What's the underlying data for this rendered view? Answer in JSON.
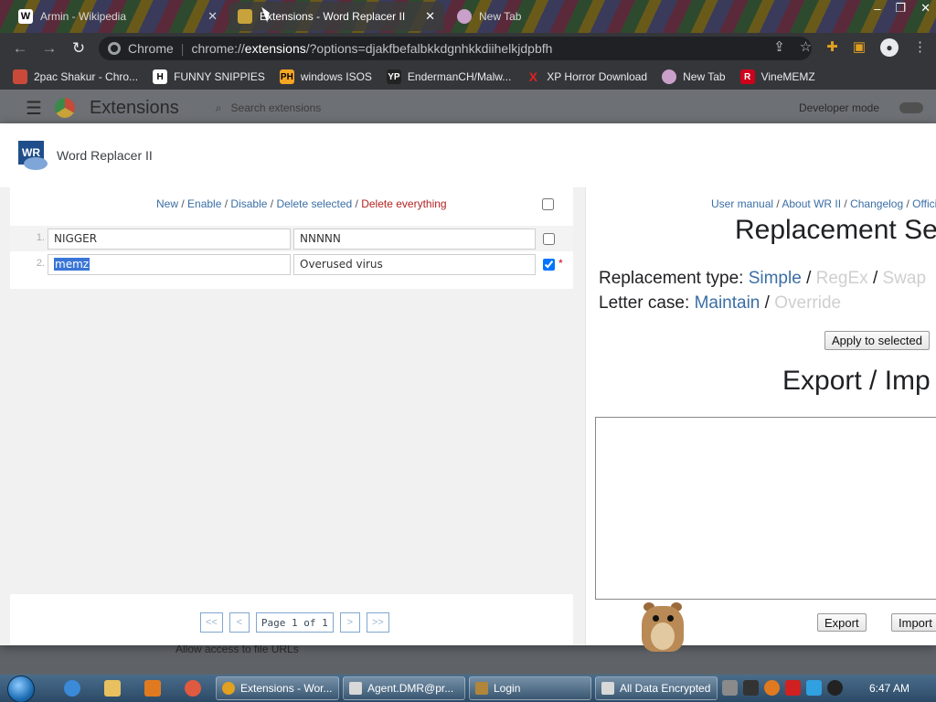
{
  "browser": {
    "tabs": [
      {
        "label": "Armin - Wikipedia",
        "icon_letter": "W"
      },
      {
        "label": "Extensions - Word Replacer II",
        "icon_letter": ""
      },
      {
        "label": "New Tab",
        "icon_letter": ""
      }
    ],
    "omnibox": {
      "site_label": "Chrome",
      "url_scheme": "chrome://",
      "url_host": "extensions",
      "url_rest": "/?options=djakfbefalbkkdgnhkkdiihelkjdpbfh"
    },
    "bookmarks": [
      {
        "label": "2pac Shakur - Chro...",
        "icon": "2pac-icon",
        "color": "#c94a3a"
      },
      {
        "label": "FUNNY SNIPPIES",
        "icon": "H",
        "color": "#ffffff"
      },
      {
        "label": "windows ISOS",
        "icon": "PH",
        "color": "#f5a623"
      },
      {
        "label": "EndermanCH/Malw...",
        "icon": "YP",
        "color": "#222222"
      },
      {
        "label": "XP Horror Download",
        "icon": "X",
        "color": "#e02020"
      },
      {
        "label": "New Tab",
        "icon": "globe-icon",
        "color": "#c9a0c9"
      },
      {
        "label": "VineMEMZ",
        "icon": "R",
        "color": "#d0021b"
      }
    ]
  },
  "extensions_page": {
    "title": "Extensions",
    "search_placeholder": "Search extensions",
    "developer_mode": "Developer mode",
    "allow_file_urls": "Allow access to file URLs"
  },
  "dialog": {
    "title": "Word Replacer II",
    "logo_text": "WR",
    "actions": {
      "new": "New",
      "enable": "Enable",
      "disable": "Disable",
      "delete_selected": "Delete selected",
      "delete_everything": "Delete everything",
      "sep": " / "
    },
    "rows": [
      {
        "num": "1.",
        "find": "NIGGER",
        "replace": "NNNNN",
        "checked": false
      },
      {
        "num": "2.",
        "find": "memz",
        "replace": "Overused virus",
        "checked": true,
        "star": "*"
      }
    ],
    "pager": {
      "first": "<<",
      "prev": "<",
      "indicator": "Page 1 of 1",
      "next": ">",
      "last": ">>"
    },
    "right": {
      "links": {
        "manual": "User manual",
        "about": "About WR II",
        "changelog": "Changelog",
        "official": "Offici"
      },
      "settings_heading": "Replacement Se",
      "type_label": "Replacement type:",
      "type_simple": "Simple",
      "type_regex": "RegEx",
      "type_swap": "Swap",
      "case_label": "Letter case:",
      "case_maintain": "Maintain",
      "case_override": "Override",
      "apply_button": "Apply to selected",
      "export_heading": "Export / Imp",
      "export_button": "Export",
      "import_button": "Import"
    }
  },
  "taskbar": {
    "buttons": [
      {
        "label": "Extensions - Wor...",
        "color": "#e0a020"
      },
      {
        "label": "Agent.DMR@pr...",
        "color": "#d8d8d8"
      },
      {
        "label": "Login",
        "color": "#b0863a"
      },
      {
        "label": "All Data Encrypted",
        "color": "#d8d8d8"
      }
    ],
    "clock": "6:47 AM"
  }
}
